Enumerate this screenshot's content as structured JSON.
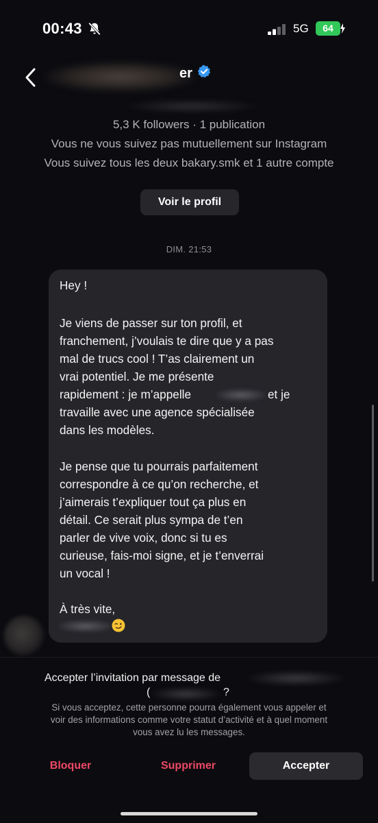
{
  "status_bar": {
    "time": "00:43",
    "network": "5G",
    "battery": "64",
    "mute_icon": "bell-slash-icon",
    "signal_icon": "cellular-signal-icon",
    "battery_color": "#32c759"
  },
  "header": {
    "back_icon": "chevron-left-icon",
    "name_visible_suffix": "er",
    "verified_icon": "verified-badge-icon",
    "verified_color": "#3897f0"
  },
  "profile": {
    "followers_line": "5,3 K followers · 1 publication",
    "mutual_line": "Vous ne vous suivez pas mutuellement sur Instagram",
    "also_follow_line": "Vous suivez tous les deux bakary.smk et 1 autre compte",
    "view_profile_label": "Voir le profil"
  },
  "conversation": {
    "timestamp": "DIM. 21:53",
    "message_lines": [
      "Hey !",
      "Je viens de passer sur ton profil, et",
      "franchement, j’voulais te dire que y a pas",
      "mal de trucs cool ! T’as clairement un",
      "vrai potentiel. Je me présente",
      "rapidement : je m’appelle",
      "et je",
      "travaille avec une agence spécialisée",
      "dans les modèles.",
      "Je pense que tu pourrais parfaitement",
      "correspondre à ce qu’on recherche, et",
      "j’aimerais t’expliquer tout ça plus en",
      "détail. Ce serait plus sympa de t’en",
      "parler de vive voix, donc si tu es",
      "curieuse, fais-moi signe, et je t’enverrai",
      "un vocal !",
      "À très vite,"
    ],
    "signature_emoji": "winking-face-emoji"
  },
  "request": {
    "invite_text": "Accepter l’invitation par message de",
    "paren_open": "(",
    "paren_close": "?",
    "disclaimer_lines": [
      "Si vous acceptez, cette personne pourra également vous appeler et",
      "voir des informations comme votre statut d’activité et à quel moment",
      "vous avez lu les messages."
    ],
    "block_label": "Bloquer",
    "delete_label": "Supprimer",
    "accept_label": "Accepter",
    "danger_color": "#ed4965"
  }
}
